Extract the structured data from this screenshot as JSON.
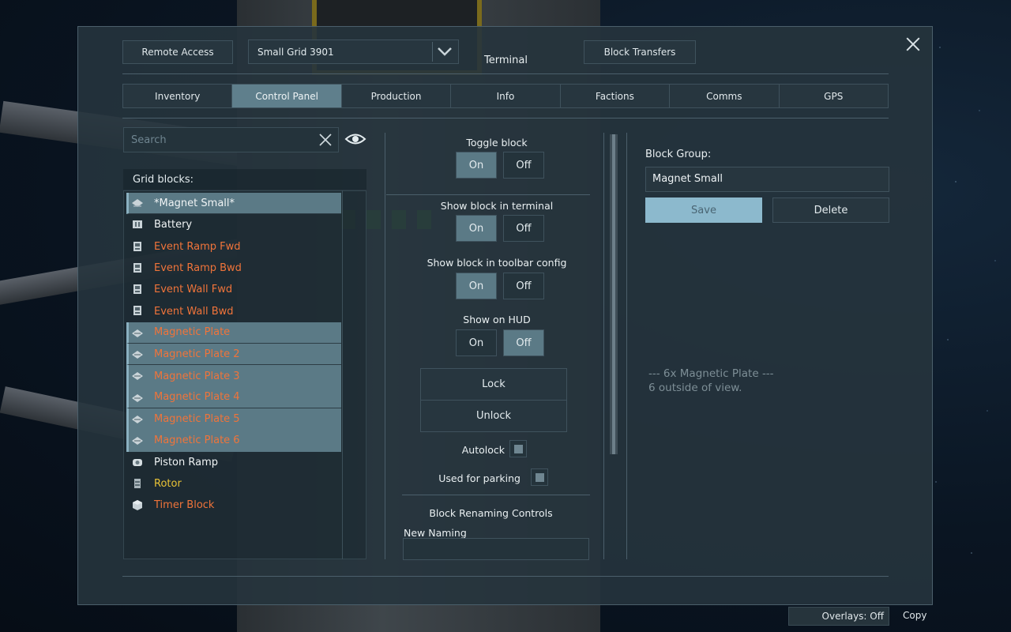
{
  "header": {
    "remote_access": "Remote Access",
    "grid_selector": "Small Grid 3901",
    "title": "Terminal",
    "block_transfers": "Block Transfers"
  },
  "tabs": [
    {
      "label": "Inventory",
      "active": false
    },
    {
      "label": "Control Panel",
      "active": true
    },
    {
      "label": "Production",
      "active": false
    },
    {
      "label": "Info",
      "active": false
    },
    {
      "label": "Factions",
      "active": false
    },
    {
      "label": "Comms",
      "active": false
    },
    {
      "label": "GPS",
      "active": false
    }
  ],
  "search": {
    "placeholder": "Search"
  },
  "grid_blocks": {
    "label": "Grid blocks:",
    "items": [
      {
        "label": "*Magnet Small*",
        "color": "white",
        "selected": true,
        "icon": "group-icon"
      },
      {
        "label": "Battery",
        "color": "white",
        "selected": false,
        "icon": "battery-icon"
      },
      {
        "label": "Event Ramp Fwd",
        "color": "orange",
        "selected": false,
        "icon": "event-controller-icon"
      },
      {
        "label": "Event Ramp Bwd",
        "color": "orange",
        "selected": false,
        "icon": "event-controller-icon"
      },
      {
        "label": "Event Wall Fwd",
        "color": "orange",
        "selected": false,
        "icon": "event-controller-icon"
      },
      {
        "label": "Event Wall Bwd",
        "color": "orange",
        "selected": false,
        "icon": "event-controller-icon"
      },
      {
        "label": "Magnetic Plate",
        "color": "orange",
        "selected": true,
        "icon": "magnetic-plate-icon"
      },
      {
        "label": "Magnetic Plate 2",
        "color": "orange",
        "selected": true,
        "icon": "magnetic-plate-icon"
      },
      {
        "label": "Magnetic Plate 3",
        "color": "orange",
        "selected": true,
        "icon": "magnetic-plate-icon"
      },
      {
        "label": "Magnetic Plate 4",
        "color": "orange",
        "selected": true,
        "icon": "magnetic-plate-icon"
      },
      {
        "label": "Magnetic Plate 5",
        "color": "orange",
        "selected": true,
        "icon": "magnetic-plate-icon"
      },
      {
        "label": "Magnetic Plate 6",
        "color": "orange",
        "selected": true,
        "icon": "magnetic-plate-icon"
      },
      {
        "label": "Piston Ramp",
        "color": "white",
        "selected": false,
        "icon": "piston-icon"
      },
      {
        "label": "Rotor",
        "color": "yellow",
        "selected": false,
        "icon": "rotor-icon"
      },
      {
        "label": "Timer Block",
        "color": "orange",
        "selected": false,
        "icon": "timer-block-icon"
      }
    ]
  },
  "controls": {
    "toggle_block": {
      "label": "Toggle block",
      "on": "On",
      "off": "Off",
      "value": "on"
    },
    "show_in_terminal": {
      "label": "Show block in terminal",
      "on": "On",
      "off": "Off",
      "value": "on"
    },
    "show_in_toolbar": {
      "label": "Show block in toolbar config",
      "on": "On",
      "off": "Off",
      "value": "on"
    },
    "show_on_hud": {
      "label": "Show on HUD",
      "on": "On",
      "off": "Off",
      "value": "off"
    },
    "lock": "Lock",
    "unlock": "Unlock",
    "autolock": "Autolock",
    "used_for_parking": "Used for parking",
    "renaming_title": "Block Renaming Controls",
    "new_naming": "New Naming"
  },
  "block_group": {
    "label": "Block Group:",
    "name": "Magnet Small",
    "save": "Save",
    "delete": "Delete",
    "info_line1": "--- 6x Magnetic Plate ---",
    "info_line2": "6 outside of view."
  },
  "footer": {
    "overlays": "Overlays: Off",
    "copy": "Copy"
  },
  "colors": {
    "white": "#f0f4f5",
    "orange": "#f0743a",
    "yellow": "#e8c236",
    "accent": "#8cb9cd",
    "selected": "#5b7a86"
  }
}
